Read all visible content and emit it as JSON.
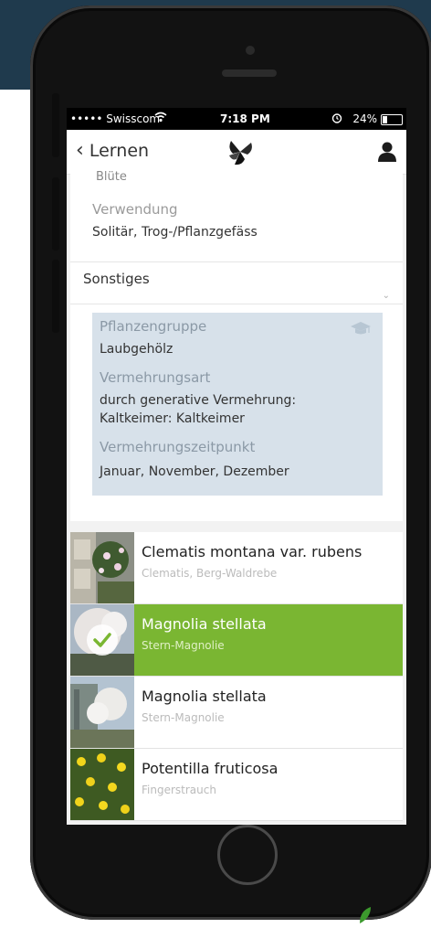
{
  "status": {
    "carrier": "••••• Swisscom",
    "time": "7:18 PM",
    "battery": "24%"
  },
  "nav": {
    "back_label": "Lernen"
  },
  "details": {
    "cut_label": "Blüte",
    "verwendung_label": "Verwendung",
    "verwendung_value": "Solitär, Trog-/Pflanzgefäss",
    "section_title": "Sonstiges",
    "pflanzengruppe_label": "Pflanzengruppe",
    "pflanzengruppe_value": "Laubgehölz",
    "vermehrungsart_label": "Vermehrungsart",
    "vermehrungsart_value": "durch generative Vermehrung: Kaltkeimer: Kaltkeimer",
    "vermehrungszeitpunkt_label": "Vermehrungszeitpunkt",
    "vermehrungszeitpunkt_value": "Januar, November, Dezember"
  },
  "plants": [
    {
      "title": "Clematis montana var. rubens",
      "subtitle": "Clematis, Berg-Waldrebe",
      "selected": false
    },
    {
      "title": "Magnolia stellata",
      "subtitle": "Stern-Magnolie",
      "selected": true
    },
    {
      "title": "Magnolia stellata",
      "subtitle": "Stern-Magnolie",
      "selected": false
    },
    {
      "title": "Potentilla fruticosa",
      "subtitle": "Fingerstrauch",
      "selected": false
    }
  ],
  "colors": {
    "accent_green": "#7ab632",
    "info_box": "#d7e1ea",
    "top_band": "#1f3a4d"
  },
  "icons": [
    "back-chevron-icon",
    "app-logo-icon",
    "profile-icon",
    "graduation-cap-icon",
    "chevron-down-icon",
    "checkmark-icon",
    "wifi-icon",
    "alarm-icon",
    "battery-icon"
  ]
}
